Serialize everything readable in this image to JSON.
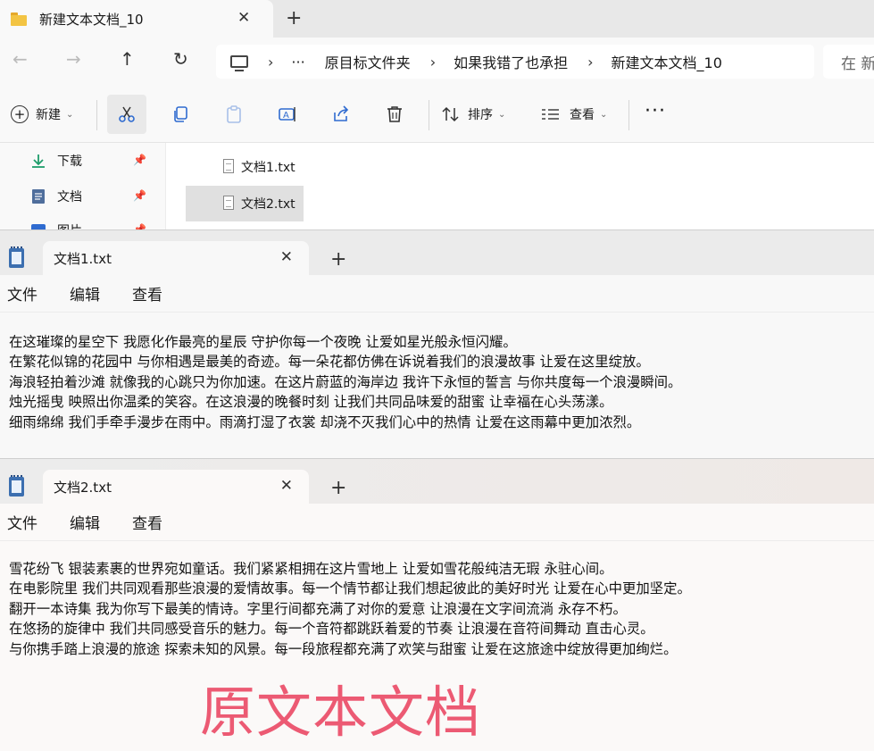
{
  "explorer": {
    "tab_title": "新建文本文档_10",
    "address": {
      "ellipsis": "···",
      "crumbs": [
        "原目标文件夹",
        "如果我错了也承担",
        "新建文本文档_10"
      ],
      "search_placeholder": "在 新"
    },
    "toolbar": {
      "new_label": "新建",
      "sort_label": "排序",
      "view_label": "查看",
      "more_label": "···"
    },
    "sidebar": {
      "items": [
        {
          "label": "下载",
          "icon": "download-icon"
        },
        {
          "label": "文档",
          "icon": "document-icon"
        },
        {
          "label": "图片",
          "icon": "picture-icon"
        }
      ]
    },
    "files": [
      {
        "name": "文档1.txt",
        "selected": false
      },
      {
        "name": "文档2.txt",
        "selected": true
      }
    ]
  },
  "notepad1": {
    "tab_title": "文档1.txt",
    "menu": [
      "文件",
      "编辑",
      "查看"
    ],
    "lines": [
      "在这璀璨的星空下 我愿化作最亮的星辰 守护你每一个夜晚 让爱如星光般永恒闪耀。",
      "在繁花似锦的花园中 与你相遇是最美的奇迹。每一朵花都仿佛在诉说着我们的浪漫故事 让爱在这里绽放。",
      "海浪轻拍着沙滩 就像我的心跳只为你加速。在这片蔚蓝的海岸边 我许下永恒的誓言 与你共度每一个浪漫瞬间。",
      "烛光摇曳 映照出你温柔的笑容。在这浪漫的晚餐时刻 让我们共同品味爱的甜蜜 让幸福在心头荡漾。",
      "细雨绵绵 我们手牵手漫步在雨中。雨滴打湿了衣裳 却浇不灭我们心中的热情 让爱在这雨幕中更加浓烈。"
    ]
  },
  "notepad2": {
    "tab_title": "文档2.txt",
    "menu": [
      "文件",
      "编辑",
      "查看"
    ],
    "lines": [
      "雪花纷飞 银装素裹的世界宛如童话。我们紧紧相拥在这片雪地上 让爱如雪花般纯洁无瑕 永驻心间。",
      "在电影院里 我们共同观看那些浪漫的爱情故事。每一个情节都让我们想起彼此的美好时光 让爱在心中更加坚定。",
      "翻开一本诗集 我为你写下最美的情诗。字里行间都充满了对你的爱意 让浪漫在文字间流淌 永存不朽。",
      "在悠扬的旋律中 我们共同感受音乐的魅力。每一个音符都跳跃着爱的节奏 让浪漫在音符间舞动 直击心灵。",
      "与你携手踏上浪漫的旅途 探索未知的风景。每一段旅程都充满了欢笑与甜蜜 让爱在这旅途中绽放得更加绚烂。"
    ]
  },
  "overlay_caption": "原文本文档",
  "colors": {
    "caption": "#ec5a73",
    "folder": "#f3c443",
    "notepad_icon": "#3c6fb0",
    "download_icon": "#1f9d6b"
  }
}
